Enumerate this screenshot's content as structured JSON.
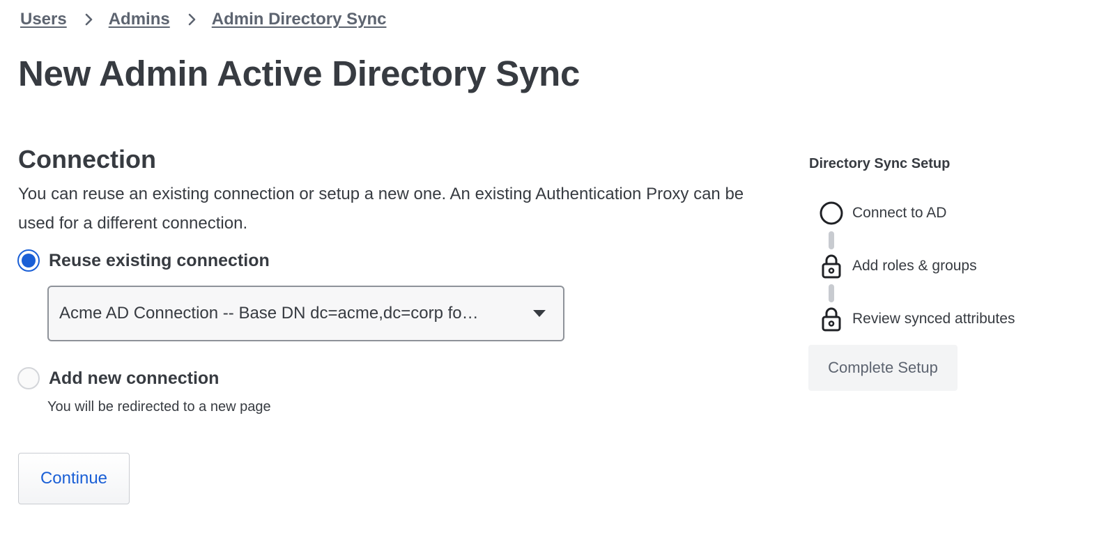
{
  "breadcrumb": {
    "items": [
      {
        "label": "Users"
      },
      {
        "label": "Admins"
      },
      {
        "label": "Admin Directory Sync"
      }
    ]
  },
  "page": {
    "title": "New Admin Active Directory Sync"
  },
  "connection": {
    "heading": "Connection",
    "description": "You can reuse an existing connection or setup a new one. An existing Authentication Proxy can be used for a different connection.",
    "options": [
      {
        "label": "Reuse existing connection",
        "checked": true
      },
      {
        "label": "Add new connection",
        "checked": false
      }
    ],
    "select_value": "Acme AD Connection -- Base DN dc=acme,dc=corp fo…",
    "add_helper": "You will be redirected to a new page",
    "continue_label": "Continue"
  },
  "setup": {
    "title": "Directory Sync Setup",
    "steps": [
      {
        "label": "Connect to AD",
        "icon": "circle-outline-icon"
      },
      {
        "label": "Add roles & groups",
        "icon": "lock-icon"
      },
      {
        "label": "Review synced attributes",
        "icon": "lock-icon"
      }
    ],
    "complete_label": "Complete Setup"
  },
  "colors": {
    "accent": "#1a5fd6",
    "text": "#373b41",
    "muted": "#5d6470",
    "connector": "#c8cbd0"
  }
}
